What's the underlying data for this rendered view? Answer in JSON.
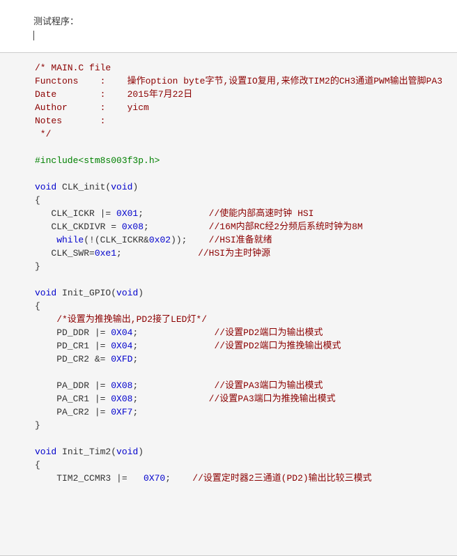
{
  "intro": {
    "title": "测试程序："
  },
  "code": {
    "c1": "/* MAIN.C file",
    "c2a": "Functons    :    ",
    "c2b": "操作option byte字节,设置IO复用,来修改TIM2的CH3通道PWM输出管脚PA3",
    "c3": "Date        :    2015年7月22日",
    "c4": "Author      :    yicm",
    "c5": "Notes       :",
    "c6": " */",
    "inc": "#include<stm8s003f3p.h>",
    "f1_sig_pre": "void",
    "f1_sig_mid": " CLK_init(",
    "f1_sig_arg": "void",
    "f1_sig_end": ")",
    "f1_l1a": "   CLK_ICKR |= ",
    "f1_l1b": "0X01",
    "f1_l1c": ";            ",
    "f1_l1d": "//使能内部高速时钟 HSI",
    "f1_l2a": "   CLK_CKDIVR = ",
    "f1_l2b": "0x08",
    "f1_l2c": ";           ",
    "f1_l2d": "//16M内部RC经2分频后系统时钟为8M",
    "f1_l3a": "    while",
    "f1_l3b": "(!(CLK_ICKR&",
    "f1_l3c": "0x02",
    "f1_l3d": "));    ",
    "f1_l3e": "//HSI准备就绪",
    "f1_l4a": "   CLK_SWR=",
    "f1_l4b": "0xe1",
    "f1_l4c": ";              ",
    "f1_l4d": "//HSI为主时钟源",
    "f2_sig_pre": "void",
    "f2_sig_mid": " Init_GPIO(",
    "f2_sig_arg": "void",
    "f2_sig_end": ")",
    "f2_c1": "    /*设置为推挽输出,PD2接了LED灯*/",
    "f2_l1a": "    PD_DDR |= ",
    "f2_l1b": "0X04",
    "f2_l1c": ";              ",
    "f2_l1d": "//设置PD2端口为输出模式",
    "f2_l2a": "    PD_CR1 |= ",
    "f2_l2b": "0X04",
    "f2_l2c": ";              ",
    "f2_l2d": "//设置PD2端口为推挽输出模式",
    "f2_l3a": "    PD_CR2 &= ",
    "f2_l3b": "0XFD",
    "f2_l3c": ";",
    "f2_l4a": "    PA_DDR |= ",
    "f2_l4b": "0X08",
    "f2_l4c": ";              ",
    "f2_l4d": "//设置PA3端口为输出模式",
    "f2_l5a": "    PA_CR1 |= ",
    "f2_l5b": "0X08",
    "f2_l5c": ";             ",
    "f2_l5d": "//设置PA3端口为推挽输出模式",
    "f2_l6a": "    PA_CR2 |= ",
    "f2_l6b": "0XF7",
    "f2_l6c": ";",
    "f3_sig_pre": "void",
    "f3_sig_mid": " Init_Tim2(",
    "f3_sig_arg": "void",
    "f3_sig_end": ")",
    "f3_l1a": "    TIM2_CCMR3 |=   ",
    "f3_l1b": "0X70",
    "f3_l1c": ";    ",
    "f3_l1d": "//设置定时器2三通道(PD2)输出比较三模式",
    "lb": "{",
    "rb": "}"
  }
}
